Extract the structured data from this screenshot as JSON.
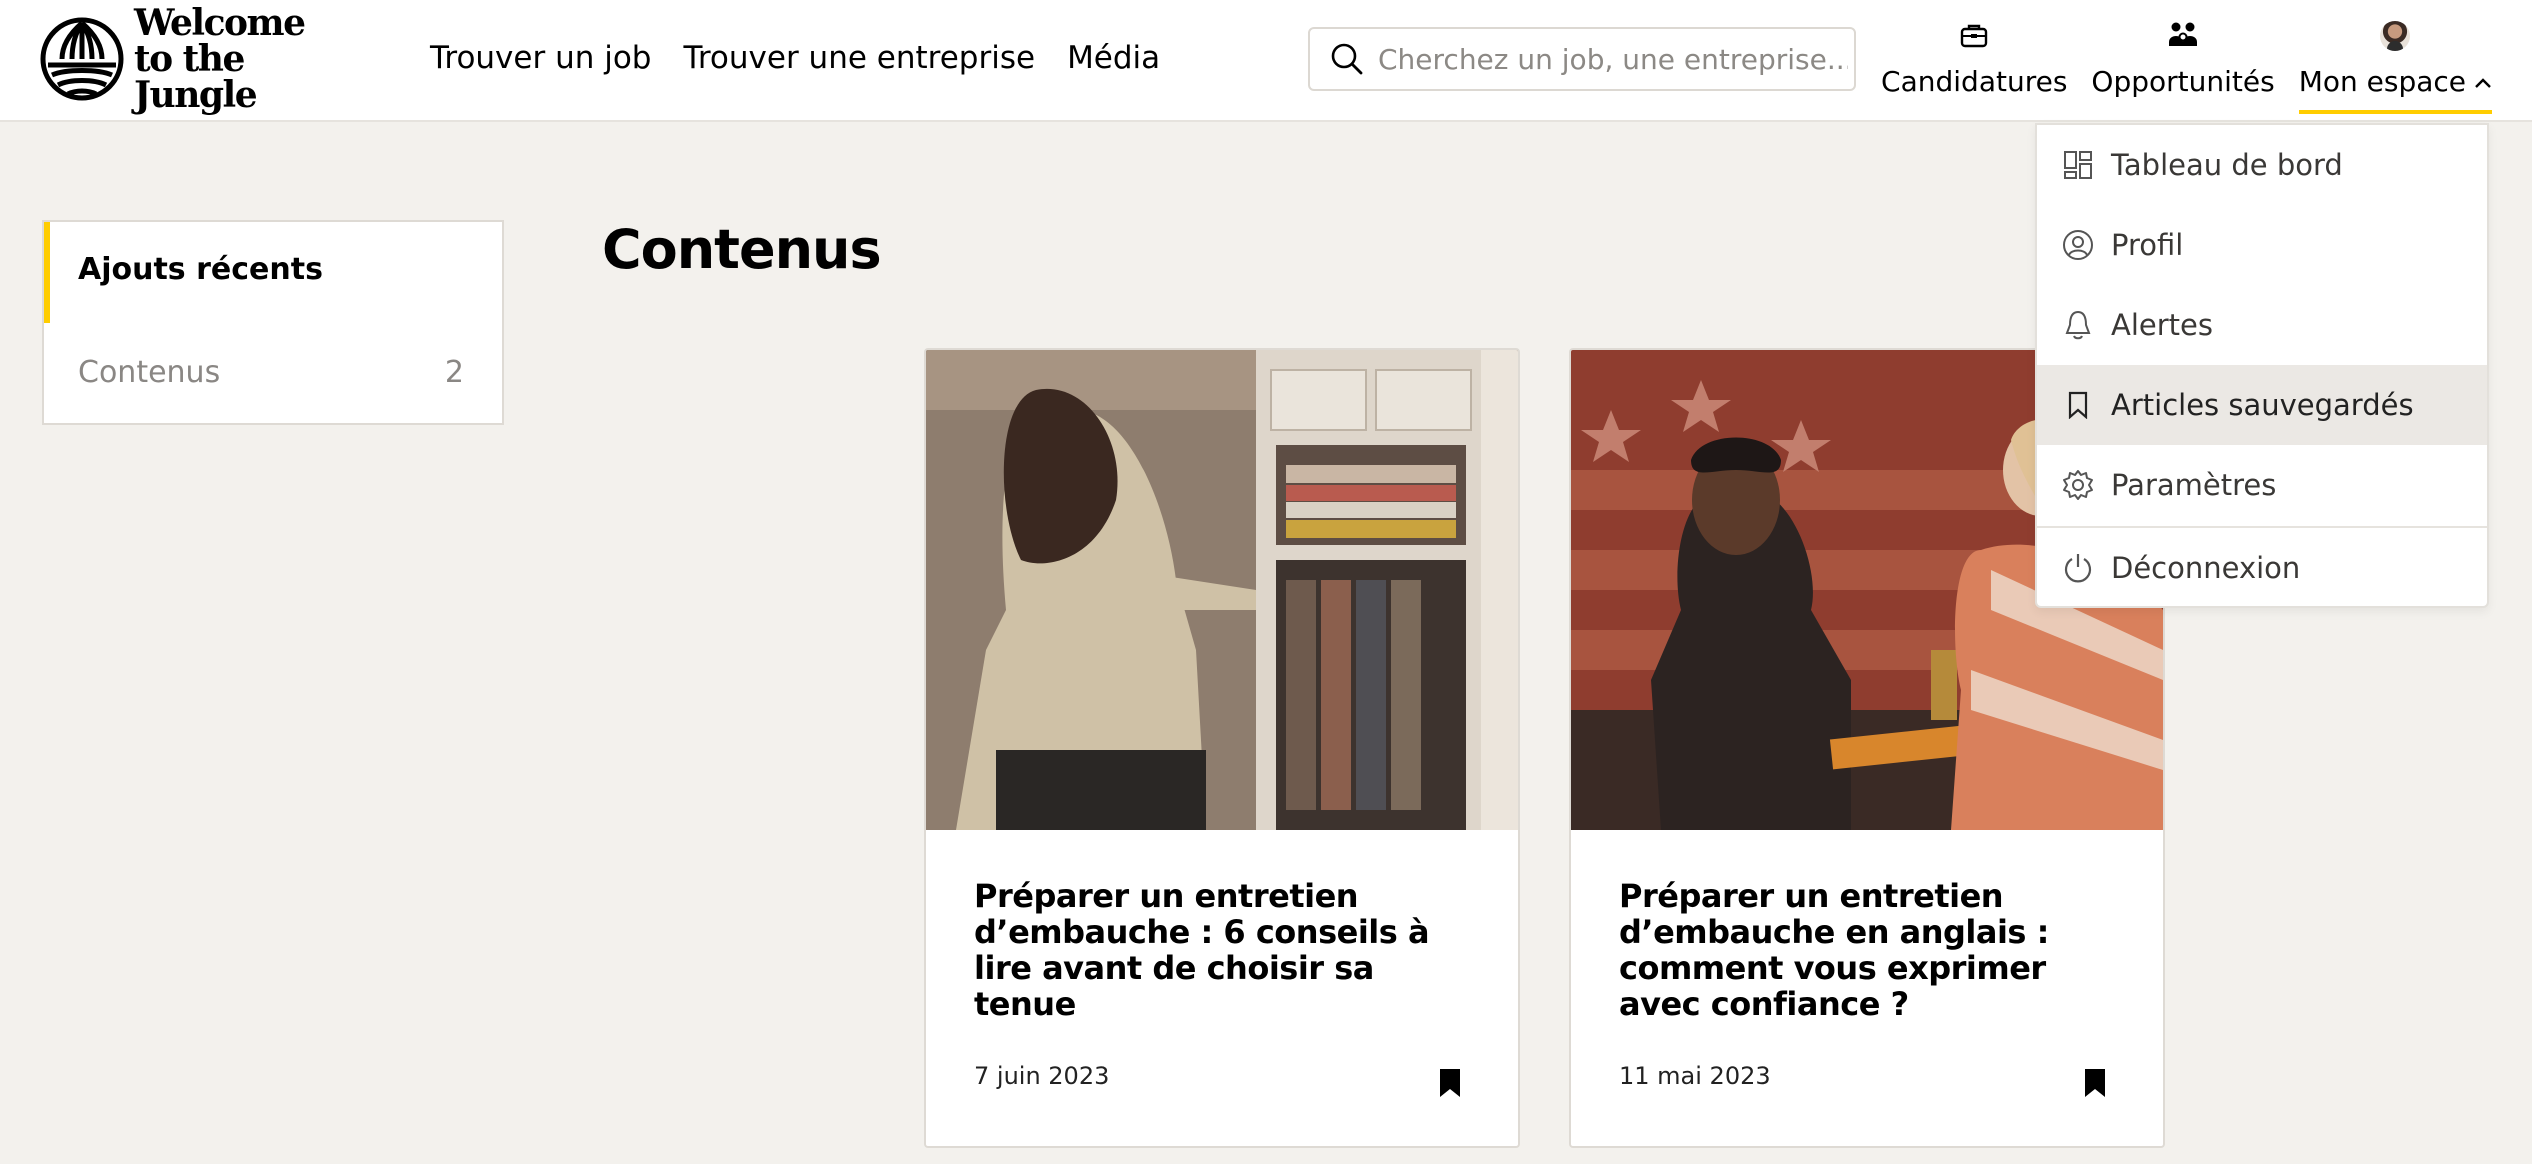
{
  "brand": {
    "name_line1": "Welcome",
    "name_line2": "to the Jungle",
    "accent_color": "#ffcd00"
  },
  "header": {
    "nav": [
      {
        "label": "Trouver un job"
      },
      {
        "label": "Trouver une entreprise"
      },
      {
        "label": "Média"
      }
    ],
    "search": {
      "placeholder": "Cherchez un job, une entreprise...",
      "value": ""
    },
    "user_nav": [
      {
        "label": "Candidatures",
        "icon": "briefcase-icon"
      },
      {
        "label": "Opportunités",
        "icon": "people-icon"
      },
      {
        "label": "Mon espace",
        "icon": "avatar",
        "active": true,
        "expanded": true
      }
    ]
  },
  "sidebar": {
    "items": [
      {
        "label": "Ajouts récents",
        "active": true
      },
      {
        "label": "Contenus",
        "count": "2"
      }
    ]
  },
  "main": {
    "title": "Contenus",
    "cards": [
      {
        "title": "Préparer un entretien d’embauche : 6 conseils à lire avant de choisir sa tenue",
        "date": "7 juin 2023",
        "bookmarked": true
      },
      {
        "title": "Préparer un entretien d’embauche en anglais : comment vous exprimer avec confiance ?",
        "date": "11 mai 2023",
        "bookmarked": true
      }
    ]
  },
  "dropdown": {
    "items": [
      {
        "label": "Tableau de bord",
        "icon": "dashboard-icon"
      },
      {
        "label": "Profil",
        "icon": "user-circle-icon"
      },
      {
        "label": "Alertes",
        "icon": "bell-icon"
      },
      {
        "label": "Articles sauvegardés",
        "icon": "bookmark-icon",
        "hover": true
      },
      {
        "label": "Paramètres",
        "icon": "gear-icon"
      },
      {
        "label": "Déconnexion",
        "icon": "power-icon"
      }
    ]
  }
}
